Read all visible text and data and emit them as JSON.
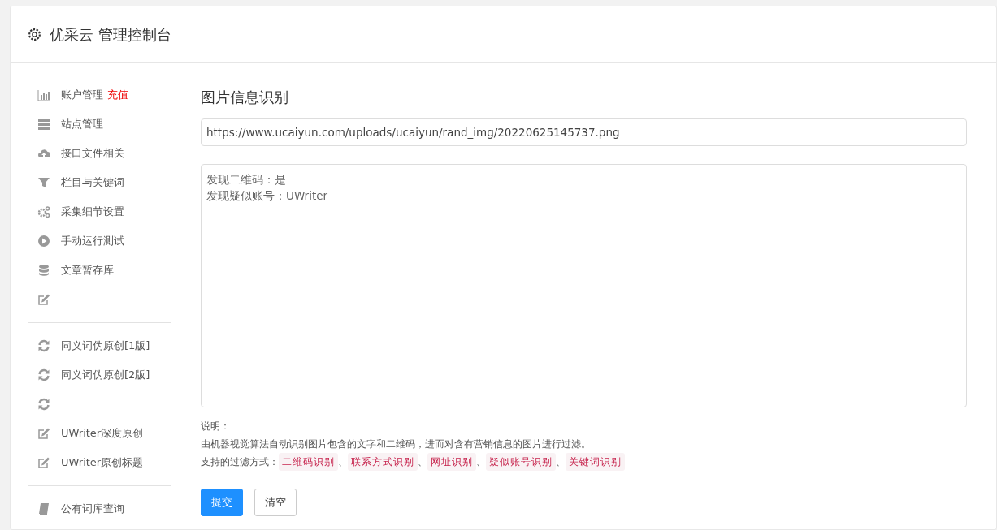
{
  "header": {
    "title": "优采云 管理控制台"
  },
  "sidebar": {
    "groups": [
      {
        "items": [
          {
            "kind": "chart",
            "label": "账户管理",
            "badge": "充值"
          },
          {
            "kind": "server",
            "label": "站点管理"
          },
          {
            "kind": "cloud",
            "label": "接口文件相关"
          },
          {
            "kind": "filter",
            "label": "栏目与关键词"
          },
          {
            "kind": "gears",
            "label": "采集细节设置"
          },
          {
            "kind": "play",
            "label": "手动运行测试"
          },
          {
            "kind": "database",
            "label": "文章暂存库"
          },
          {
            "kind": "edit"
          }
        ]
      },
      {
        "items": [
          {
            "kind": "refresh",
            "label": "同义词伪原创[1版]"
          },
          {
            "kind": "refresh",
            "label": "同义词伪原创[2版]"
          },
          {
            "kind": "refresh"
          },
          {
            "kind": "edit",
            "label": "UWriter深度原创"
          },
          {
            "kind": "edit",
            "label": "UWriter原创标题"
          }
        ]
      },
      {
        "items": [
          {
            "kind": "book",
            "label": "公有词库查询"
          }
        ]
      }
    ]
  },
  "main": {
    "heading": "图片信息识别",
    "url_field": {
      "value": "https://www.ucaiyun.com/uploads/ucaiyun/rand_img/20220625145737.png"
    },
    "result_box": {
      "lines": [
        "发现二维码：是",
        "发现疑似账号：UWriter"
      ]
    },
    "notes": {
      "title": "说明：",
      "description": "由机器视觉算法自动识别图片包含的文字和二维码，进而对含有营销信息的图片进行过滤。",
      "filters_label": "支持的过滤方式：",
      "separator": "、",
      "filters": [
        "二维码识别",
        "联系方式识别",
        "网址识别",
        "疑似账号识别",
        "关键词识别"
      ]
    },
    "buttons": [
      {
        "label": "提交",
        "kind": "primary"
      },
      {
        "label": "清空",
        "kind": "default"
      }
    ]
  }
}
